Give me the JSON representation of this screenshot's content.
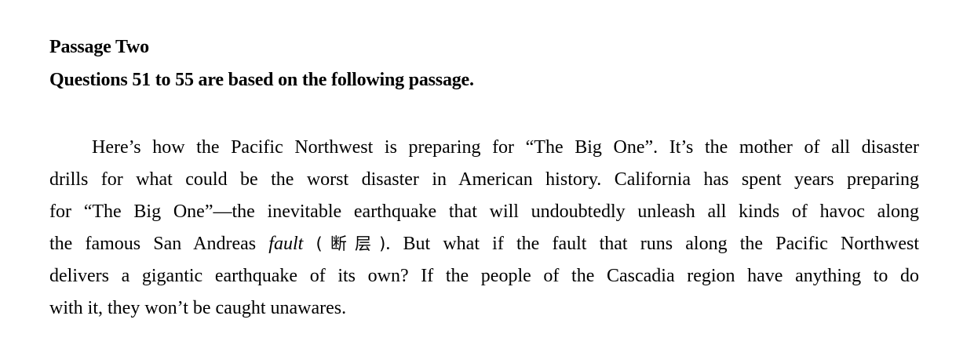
{
  "passage": {
    "title": "Passage Two",
    "instructions": "Questions 51 to 55 are based on the following passage.",
    "lines": [
      "Here’s how the Pacific Northwest is preparing for “The Big One”. It’s the mother of all disaster",
      "drills for what could be the worst disaster in American history. California has spent years preparing",
      "for “The Big One”—the inevitable earthquake that will undoubtedly unleash all kinds of havoc along"
    ],
    "line4_before": "the famous San Andreas ",
    "line4_italic": "fault",
    "line4_gloss": "(断层)",
    "line4_after": ". But what if the fault that runs along the Pacific Northwest",
    "line5": "delivers a gigantic earthquake of its own? If the people of the Cascadia region have anything to do",
    "line6": "with it, they won’t be caught unawares."
  }
}
